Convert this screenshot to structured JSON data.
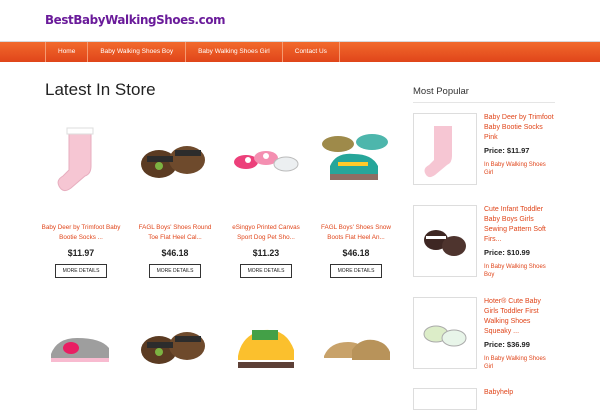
{
  "site": {
    "logo": "BestBabyWalkingShoes.com"
  },
  "nav": {
    "items": [
      "Home",
      "Baby Walking Shoes Boy",
      "Baby Walking Shoes Girl",
      "Contact Us"
    ]
  },
  "main": {
    "title": "Latest In Store",
    "products": [
      {
        "name": "Baby Deer by Trimfoot Baby Bootie Socks ...",
        "price": "$11.97",
        "button": "MORE DETAILS"
      },
      {
        "name": "FAGL Boys' Shoes Round Toe Flat Heel Cal...",
        "price": "$46.18",
        "button": "MORE DETAILS"
      },
      {
        "name": "eSingyo Printed Canvas Sport Dog Pet Sho...",
        "price": "$11.23",
        "button": "MORE DETAILS"
      },
      {
        "name": "FAGL Boys' Shoes Snow Boots Flat Heel An...",
        "price": "$46.18",
        "button": "MORE DETAILS"
      }
    ]
  },
  "sidebar": {
    "title": "Most Popular",
    "items": [
      {
        "title": "Baby Deer by Trimfoot Baby Bootie Socks Pink",
        "price": "Price: $11.97",
        "category": "In Baby Walking Shoes Girl"
      },
      {
        "title": "Cute Infant Toddler Baby Boys Girls Sewing Pattern Soft Firs...",
        "price": "Price: $10.99",
        "category": "In Baby Walking Shoes Boy"
      },
      {
        "title": "Hoter® Cute Baby Girls Toddler First Walking Shoes Squeaky ...",
        "price": "Price: $36.99",
        "category": "In Baby Walking Shoes Girl"
      },
      {
        "title": "Babyhelp"
      }
    ]
  },
  "colors": {
    "accent": "#e0451a",
    "logo": "#6a1b9a"
  }
}
